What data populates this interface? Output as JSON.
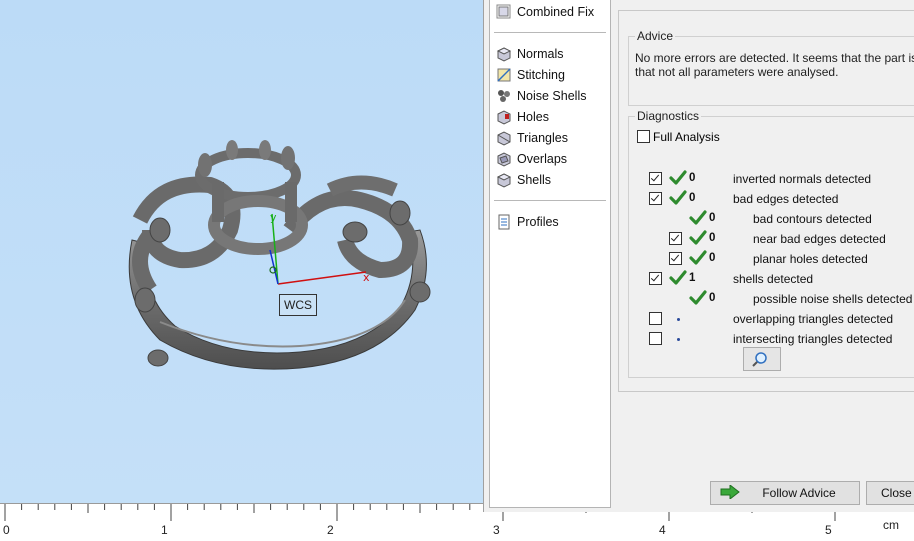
{
  "viewport": {
    "coordinate_label": "WCS",
    "axis_x_label": "x",
    "axis_y_label": "y",
    "ruler_ticks": [
      "0",
      "1",
      "2",
      "3",
      "4",
      "5"
    ],
    "ruler_unit": "cm"
  },
  "tools": {
    "combined_fix": "Combined Fix",
    "normals": "Normals",
    "stitching": "Stitching",
    "noise_shells": "Noise Shells",
    "holes": "Holes",
    "triangles": "Triangles",
    "overlaps": "Overlaps",
    "shells": "Shells",
    "profiles": "Profiles"
  },
  "advice": {
    "title": "Advice",
    "line1": "No more errors are detected. It seems that the part is ok",
    "line2": "that not all parameters were analysed."
  },
  "diagnostics": {
    "title": "Diagnostics",
    "full_analysis_label": "Full Analysis",
    "full_analysis_checked": false,
    "rows": [
      {
        "checked": true,
        "status": "ok",
        "count": "0",
        "label": "inverted normals detected"
      },
      {
        "checked": true,
        "status": "ok",
        "count": "0",
        "label": "bad edges detected"
      },
      {
        "checked": null,
        "status": "ok",
        "count": "0",
        "label": "bad contours detected"
      },
      {
        "checked": true,
        "status": "ok",
        "count": "0",
        "label": "near bad edges detected"
      },
      {
        "checked": true,
        "status": "ok",
        "count": "0",
        "label": "planar holes detected"
      },
      {
        "checked": true,
        "status": "ok",
        "count": "1",
        "label": "shells detected"
      },
      {
        "checked": null,
        "status": "ok",
        "count": "0",
        "label": "possible noise shells detected"
      },
      {
        "checked": false,
        "status": "pending",
        "count": "",
        "label": "overlapping triangles detected"
      },
      {
        "checked": false,
        "status": "pending",
        "count": "",
        "label": "intersecting triangles detected"
      }
    ]
  },
  "buttons": {
    "follow_advice": "Follow Advice",
    "close": "Close"
  },
  "icons": {
    "zoom": "magnifier-icon",
    "follow_advice": "green-arrow-icon",
    "status_ok": "green-check-icon"
  },
  "colors": {
    "viewport_bg": "#bcdbf7",
    "check_green": "#2e8b2e",
    "axis_x": "#d01010",
    "axis_y": "#18b018",
    "axis_z": "#1030d0"
  }
}
